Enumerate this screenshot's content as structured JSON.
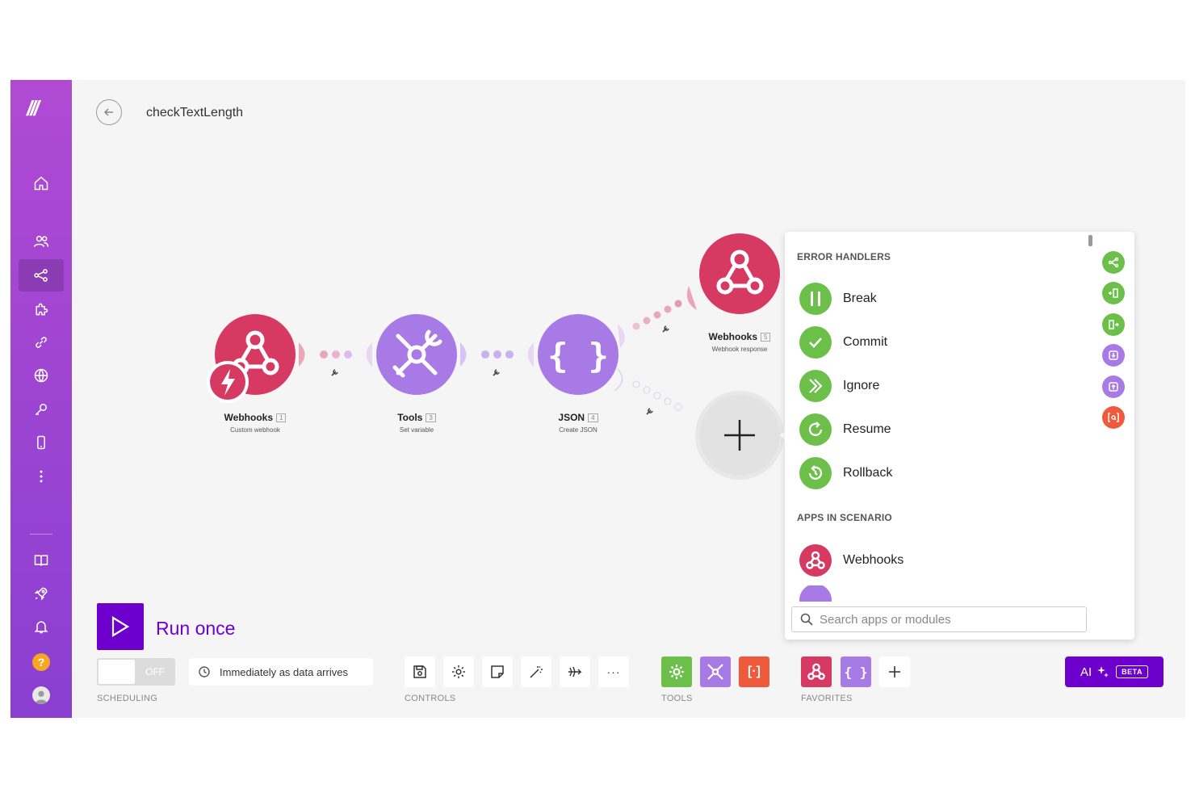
{
  "scenario": {
    "title": "checkTextLength"
  },
  "modules": [
    {
      "name": "Webhooks",
      "number": "1",
      "subtitle": "Custom webhook",
      "color": "#d63a63"
    },
    {
      "name": "Tools",
      "number": "3",
      "subtitle": "Set variable",
      "color": "#a77ae6"
    },
    {
      "name": "JSON",
      "number": "4",
      "subtitle": "Create JSON",
      "color": "#a77ae6"
    },
    {
      "name": "Webhooks",
      "number": "5",
      "subtitle": "Webhook response",
      "color": "#d63a63"
    }
  ],
  "panel": {
    "error_handlers_heading": "ERROR HANDLERS",
    "error_handlers": [
      {
        "label": "Break",
        "icon": "pause-icon",
        "color": "#6cc04a"
      },
      {
        "label": "Commit",
        "icon": "check-icon",
        "color": "#6cc04a"
      },
      {
        "label": "Ignore",
        "icon": "double-chevron-right-icon",
        "color": "#6cc04a"
      },
      {
        "label": "Resume",
        "icon": "redo-icon",
        "color": "#6cc04a"
      },
      {
        "label": "Rollback",
        "icon": "undo-icon",
        "color": "#6cc04a"
      }
    ],
    "apps_heading": "APPS IN SCENARIO",
    "apps": [
      {
        "label": "Webhooks",
        "icon": "webhook-icon",
        "color": "#d63a63"
      }
    ],
    "search_placeholder": "Search apps or modules"
  },
  "bottom": {
    "run_once_label": "Run once",
    "toggle_label": "OFF",
    "schedule_label": "Immediately as data arrives",
    "scheduling_caption": "SCHEDULING",
    "controls_caption": "CONTROLS",
    "tools_caption": "TOOLS",
    "favorites_caption": "FAVORITES",
    "more_label": "···",
    "tool_brackets": "[·]",
    "json_braces": "{ }",
    "ai_label": "AI",
    "beta_label": "BETA"
  },
  "sidebar": {
    "logo": "///",
    "help_label": "?"
  },
  "colors": {
    "brand_purple": "#6d00cc",
    "sidebar_top": "#b04ad3",
    "webhook_red": "#d63a63",
    "tools_purple": "#a77ae6",
    "handler_green": "#6cc04a",
    "tool_orange": "#f05a3c"
  }
}
